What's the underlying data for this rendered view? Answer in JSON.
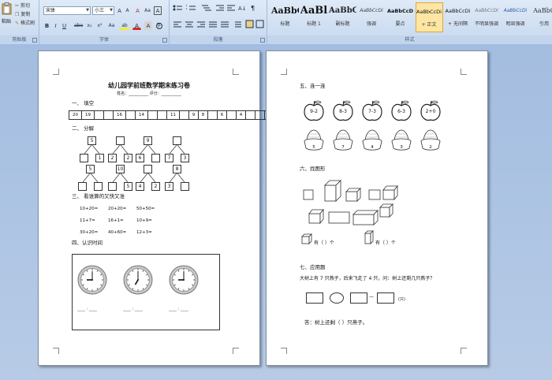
{
  "ribbon": {
    "clipboard": {
      "paste_label": "粘贴",
      "cut_label": "剪切",
      "copy_label": "复制",
      "format_painter_label": "格式刷",
      "group_label": "剪贴板"
    },
    "font": {
      "font_name": "宋体",
      "font_size": "小三",
      "bold": "B",
      "italic": "I",
      "underline": "U",
      "strike": "abe",
      "subscript": "x₂",
      "superscript": "x²",
      "change_case": "Aa",
      "highlight": "ab",
      "font_color": "A",
      "grow": "A",
      "shrink": "A",
      "clear": "A",
      "char_border": "A",
      "group_label": "字体"
    },
    "paragraph": {
      "group_label": "段落"
    },
    "styles": {
      "items": [
        {
          "sample": "AaBbC",
          "name": "标题"
        },
        {
          "sample": "AaBl",
          "name": "标题 1"
        },
        {
          "sample": "AaBbC",
          "name": "副标题"
        },
        {
          "sample": "AaBbCcDi",
          "name": "强调"
        },
        {
          "sample": "AaBbCcD",
          "name": "要点"
        },
        {
          "sample": "AaBbCcDi",
          "name": "+ 正文"
        },
        {
          "sample": "AaBbCcDi",
          "name": "+ 无间隔"
        },
        {
          "sample": "AaBbCcDi",
          "name": "不明显强调"
        },
        {
          "sample": "AaBbCcDi",
          "name": "明显强调"
        },
        {
          "sample": "AaBbC",
          "name": "引用"
        }
      ],
      "group_label": "样式"
    }
  },
  "page1": {
    "title": "幼儿园学前班数学期末练习卷",
    "subtitle": "姓名：__________ 评分：__________",
    "sec1": "一、  填空",
    "numbers": [
      "20",
      "19",
      "",
      "",
      "16",
      "",
      "14",
      "",
      "",
      "11",
      "",
      "9",
      "8",
      "",
      "6",
      "",
      "4",
      "",
      "",
      "1"
    ],
    "sec2": "二、  分解",
    "splits": [
      {
        "top": "5",
        "left": "",
        "right": "1"
      },
      {
        "top": "",
        "left": "2",
        "right": "2"
      },
      {
        "top": "9",
        "left": "6",
        "right": ""
      },
      {
        "top": "",
        "left": "7",
        "right": "3"
      },
      {
        "top": "5",
        "left": "",
        "right": ""
      },
      {
        "top": "10",
        "left": "",
        "right": "5"
      },
      {
        "top": "",
        "left": "4",
        "right": "2"
      },
      {
        "top": "8",
        "left": "3",
        "right": ""
      }
    ],
    "sec3": "三、  看谁算的又快又准",
    "calcs": [
      "10+20=",
      "20+20=",
      "50+50=",
      "11+7=",
      "16+1=",
      "10+9=",
      "30+20=",
      "40+60=",
      "12+3="
    ],
    "sec4": "四、认识时间",
    "clock_lines": [
      "____ : ____",
      "____ : ____",
      "____ : ____"
    ],
    "clocks": [
      {
        "hour": 9,
        "minute": 0
      },
      {
        "hour": 7,
        "minute": 0
      },
      {
        "hour": 9,
        "minute": 0
      }
    ]
  },
  "page2": {
    "sec5": "五、连一连",
    "apples": [
      "9-2",
      "8-3",
      "7-3",
      "6-3",
      "2+0"
    ],
    "bowls": [
      "5",
      "7",
      "4",
      "3",
      "2"
    ],
    "sec6": "六、找图形",
    "count_a": "有（    ）个",
    "count_b": "有（    ）个",
    "sec7": "七、应用题",
    "problem": "大树上有 7 只燕子，后来飞走了 4 只，问：树上还剩几只燕子？",
    "unit": "(只)",
    "minus": "—",
    "equals": "=",
    "answer": "答：树上还剩（      ）只燕子。"
  }
}
